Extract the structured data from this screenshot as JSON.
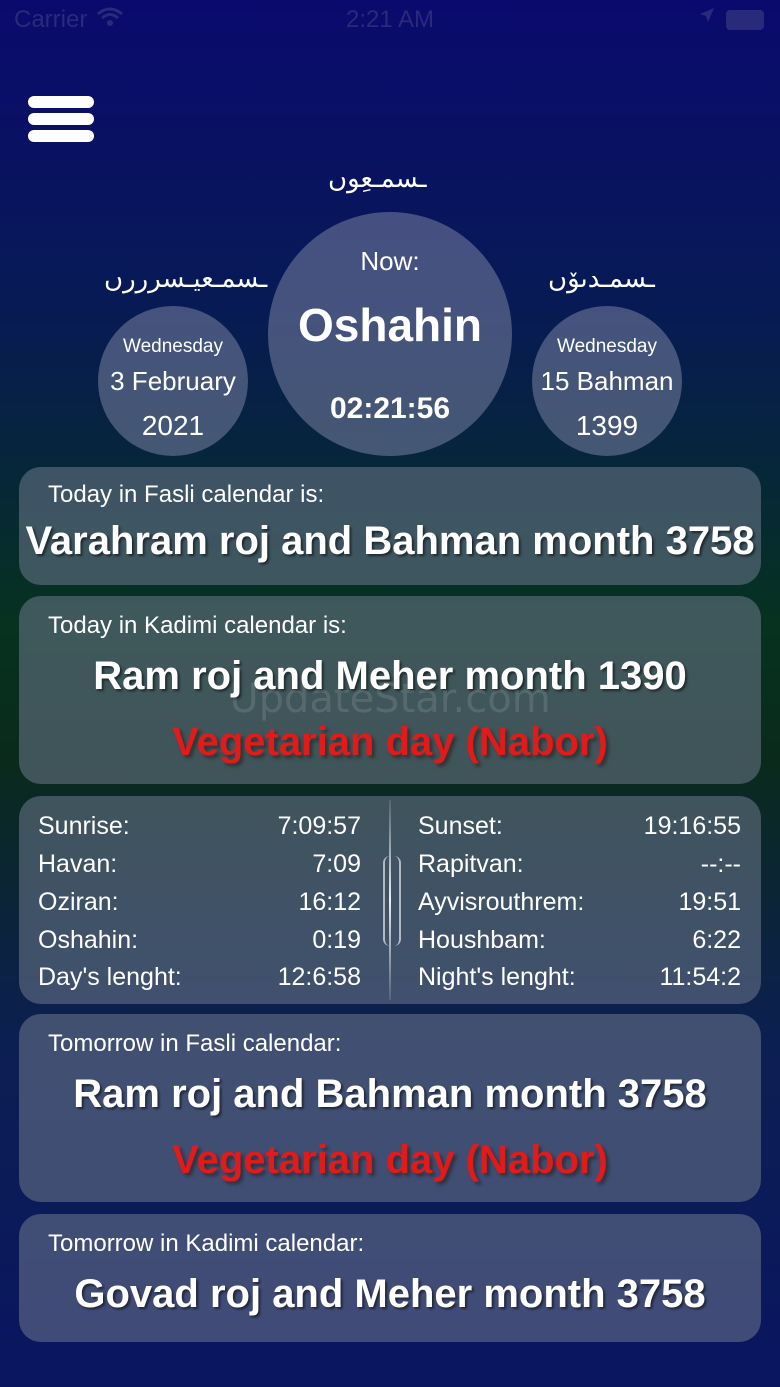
{
  "status_bar": {
    "carrier": "Carrier",
    "wifi_icon": "wifi-icon",
    "time": "2:21 AM",
    "location_icon": "location-arrow-icon",
    "battery_icon": "battery-icon"
  },
  "menu": {
    "icon": "hamburger-menu-icon"
  },
  "header_scripts": {
    "center": "ـسمـعِوں",
    "left": "ـسمـعیـسرررں",
    "right": "ـسمـدںۆں"
  },
  "now_circle": {
    "label": "Now:",
    "gah": "Oshahin",
    "clock": "02:21:56"
  },
  "gregorian": {
    "weekday": "Wednesday",
    "date": "3 February",
    "year": "2021"
  },
  "persian": {
    "weekday": "Wednesday",
    "date": "15 Bahman",
    "year": "1399"
  },
  "today_fasli": {
    "label": "Today in Fasli calendar is:",
    "value": "Varahram roj and Bahman month 3758"
  },
  "today_kadimi": {
    "label": "Today in Kadimi calendar is:",
    "value": "Ram roj and Meher month 1390",
    "note": "Vegetarian day (Nabor)"
  },
  "times": {
    "left": [
      {
        "label": "Sunrise:",
        "value": "7:09:57"
      },
      {
        "label": "Havan:",
        "value": "7:09"
      },
      {
        "label": "Oziran:",
        "value": "16:12"
      },
      {
        "label": "Oshahin:",
        "value": "0:19"
      },
      {
        "label": "Day's lenght:",
        "value": "12:6:58"
      }
    ],
    "right": [
      {
        "label": "Sunset:",
        "value": "19:16:55"
      },
      {
        "label": "Rapitvan:",
        "value": "--:--"
      },
      {
        "label": "Ayvisrouthrem:",
        "value": "19:51"
      },
      {
        "label": "Houshbam:",
        "value": "6:22"
      },
      {
        "label": "Night's lenght:",
        "value": "11:54:2"
      }
    ]
  },
  "tomorrow_fasli": {
    "label": "Tomorrow in Fasli calendar:",
    "value": "Ram roj and Bahman month 3758",
    "note": "Vegetarian day (Nabor)"
  },
  "tomorrow_kadimi": {
    "label": "Tomorrow  in Kadimi calendar:",
    "value": "Govad roj and Meher month 3758"
  },
  "watermark": "UpdateStar.com"
}
